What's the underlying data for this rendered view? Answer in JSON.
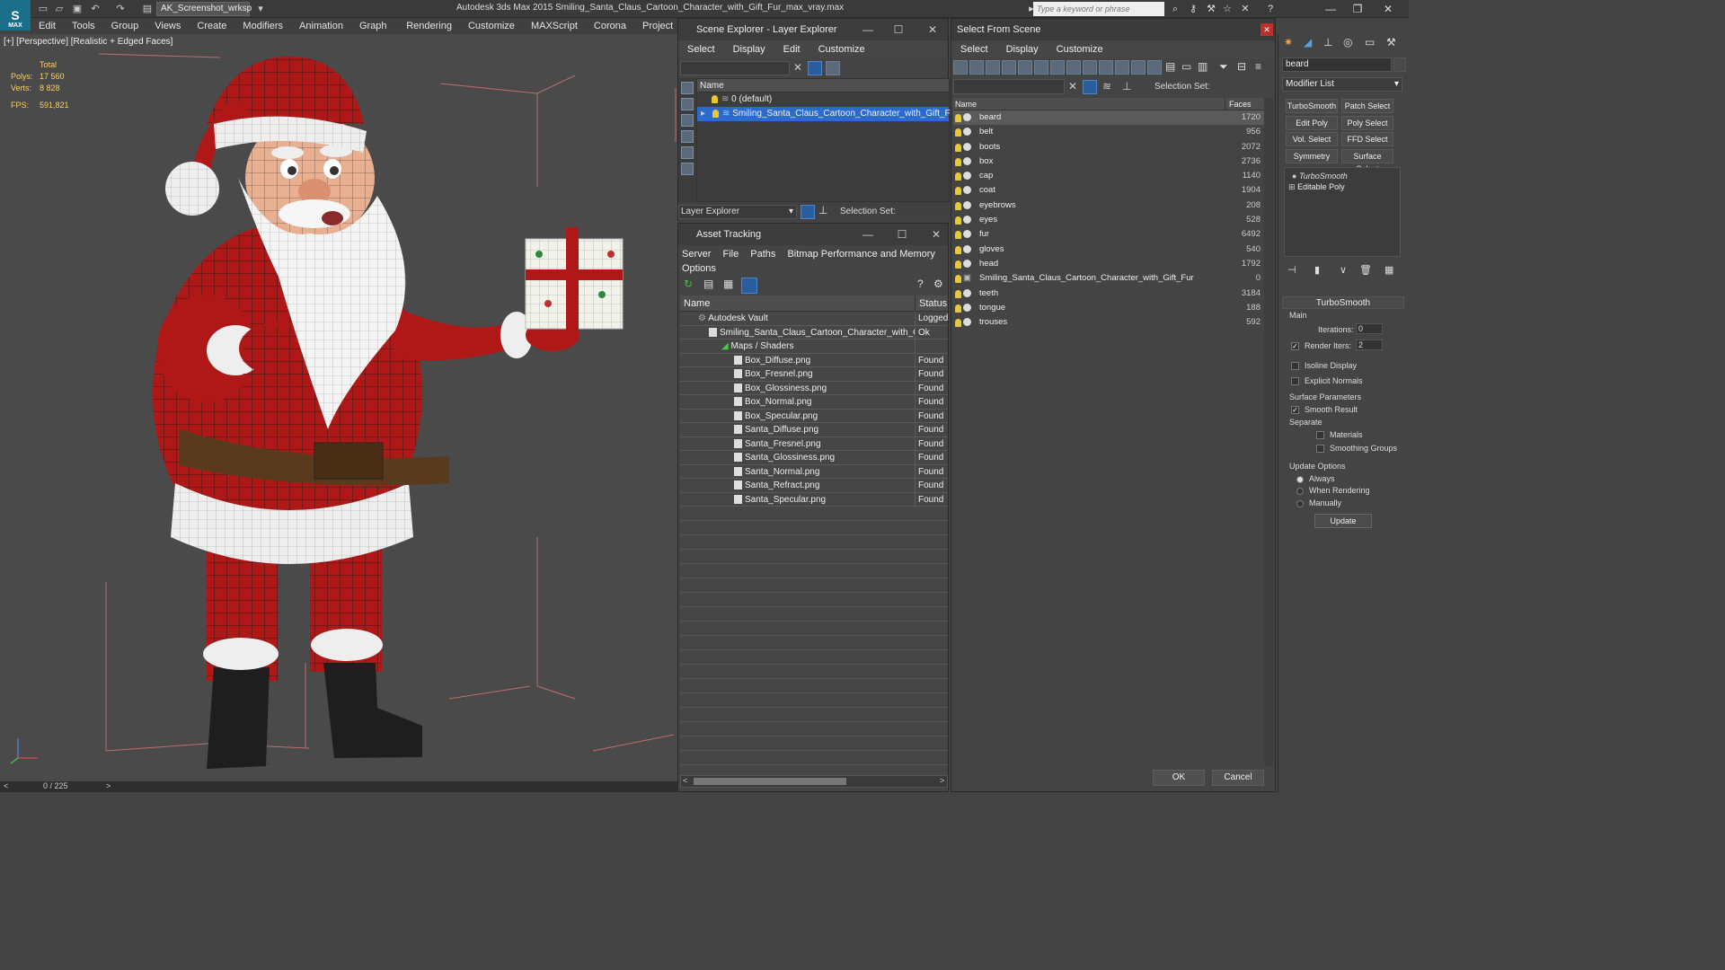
{
  "app": {
    "title": "Autodesk 3ds Max  2015    Smiling_Santa_Claus_Cartoon_Character_with_Gift_Fur_max_vray.max",
    "logo_text": "MAX",
    "workspace": "AK_Screenshot_wrksp",
    "search_placeholder": "Type a keyword or phrase"
  },
  "menu": [
    "Edit",
    "Tools",
    "Group",
    "Views",
    "Create",
    "Modifiers",
    "Animation",
    "Graph Editors",
    "Rendering",
    "Customize",
    "MAXScript",
    "Corona",
    "Project Man"
  ],
  "viewport": {
    "label": "[+] [Perspective] [Realistic + Edged Faces]",
    "stats": {
      "total_label": "Total",
      "polys_label": "Polys:",
      "polys": "17 560",
      "verts_label": "Verts:",
      "verts": "8 828",
      "fps_label": "FPS:",
      "fps": "591,821"
    },
    "timeline": "0 / 225"
  },
  "scene_explorer": {
    "title": "Scene Explorer - Layer Explorer",
    "menu": [
      "Select",
      "Display",
      "Edit",
      "Customize"
    ],
    "column": "Name",
    "rows": [
      "0 (default)",
      "Smiling_Santa_Claus_Cartoon_Character_with_Gift_Fur"
    ],
    "layer_dropdown": "Layer Explorer",
    "selection_set": "Selection Set:"
  },
  "asset_tracking": {
    "title": "Asset Tracking",
    "menu": [
      "Server",
      "File",
      "Paths",
      "Bitmap Performance and Memory",
      "Options"
    ],
    "col_name": "Name",
    "col_status": "Status",
    "rows": [
      {
        "name": "Autodesk Vault",
        "status": "Logged"
      },
      {
        "name": "Smiling_Santa_Claus_Cartoon_Character_with_Gift_Fur",
        "status": "Ok"
      },
      {
        "name": "Maps / Shaders",
        "status": ""
      },
      {
        "name": "Box_Diffuse.png",
        "status": "Found"
      },
      {
        "name": "Box_Fresnel.png",
        "status": "Found"
      },
      {
        "name": "Box_Glossiness.png",
        "status": "Found"
      },
      {
        "name": "Box_Normal.png",
        "status": "Found"
      },
      {
        "name": "Box_Specular.png",
        "status": "Found"
      },
      {
        "name": "Santa_Diffuse.png",
        "status": "Found"
      },
      {
        "name": "Santa_Fresnel.png",
        "status": "Found"
      },
      {
        "name": "Santa_Glossiness.png",
        "status": "Found"
      },
      {
        "name": "Santa_Normal.png",
        "status": "Found"
      },
      {
        "name": "Santa_Refract.png",
        "status": "Found"
      },
      {
        "name": "Santa_Specular.png",
        "status": "Found"
      }
    ]
  },
  "select_from_scene": {
    "title": "Select From Scene",
    "menu": [
      "Select",
      "Display",
      "Customize"
    ],
    "selection_set": "Selection Set:",
    "col_name": "Name",
    "col_faces": "Faces",
    "rows": [
      {
        "name": "beard",
        "faces": "1720"
      },
      {
        "name": "belt",
        "faces": "956"
      },
      {
        "name": "boots",
        "faces": "2072"
      },
      {
        "name": "box",
        "faces": "2736"
      },
      {
        "name": "cap",
        "faces": "1140"
      },
      {
        "name": "coat",
        "faces": "1904"
      },
      {
        "name": "eyebrows",
        "faces": "208"
      },
      {
        "name": "eyes",
        "faces": "528"
      },
      {
        "name": "fur",
        "faces": "6492"
      },
      {
        "name": "gloves",
        "faces": "540"
      },
      {
        "name": "head",
        "faces": "1792"
      },
      {
        "name": "Smiling_Santa_Claus_Cartoon_Character_with_Gift_Fur",
        "faces": "0"
      },
      {
        "name": "teeth",
        "faces": "3184"
      },
      {
        "name": "tongue",
        "faces": "188"
      },
      {
        "name": "trouses",
        "faces": "592"
      }
    ],
    "ok": "OK",
    "cancel": "Cancel"
  },
  "command_panel": {
    "object_name": "beard",
    "modifier_list": "Modifier List",
    "buttons": [
      "TurboSmooth",
      "Patch Select",
      "Edit Poly",
      "Poly Select",
      "Vol. Select",
      "FFD Select",
      "Symmetry",
      "Surface Select"
    ],
    "stack": [
      "TurboSmooth",
      "Editable Poly"
    ],
    "rollout": "TurboSmooth",
    "main": "Main",
    "iterations_label": "Iterations:",
    "iterations": "0",
    "render_iters_label": "Render Iters:",
    "render_iters": "2",
    "isoline": "Isoline Display",
    "explicit_normals": "Explicit Normals",
    "surface_params": "Surface Parameters",
    "smooth_result": "Smooth Result",
    "separate": "Separate",
    "materials": "Materials",
    "smoothing_groups": "Smoothing Groups",
    "update_options": "Update Options",
    "always": "Always",
    "when_rendering": "When Rendering",
    "manually": "Manually",
    "update": "Update"
  }
}
